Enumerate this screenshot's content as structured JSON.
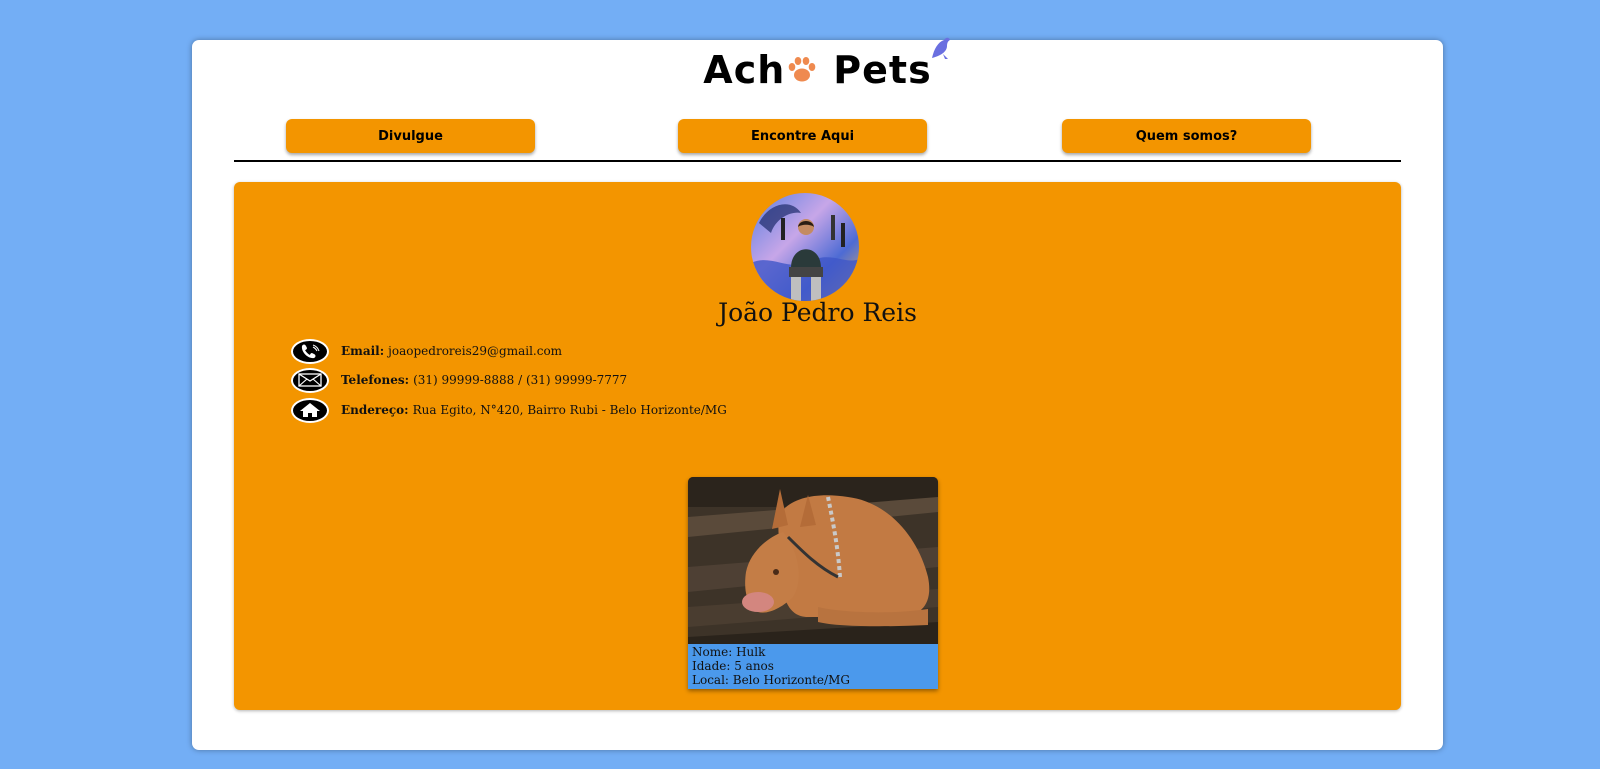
{
  "logo": {
    "part1": "Ach",
    "part2": "Pets"
  },
  "nav": {
    "items": [
      {
        "label": "Divulgue"
      },
      {
        "label": "Encontre Aqui"
      },
      {
        "label": "Quem somos?"
      }
    ]
  },
  "profile": {
    "name": "João Pedro Reis",
    "contacts": [
      {
        "label": "Email:",
        "value": "joaopedroreis29@gmail.com",
        "icon": "phone-icon"
      },
      {
        "label": "Telefones:",
        "value": "(31) 99999-8888 / (31) 99999-7777",
        "icon": "envelope-icon"
      },
      {
        "label": "Endereço:",
        "value": "Rua Egito, N°420, Bairro Rubi - Belo Horizonte/MG",
        "icon": "home-icon"
      }
    ]
  },
  "pet": {
    "name_line": "Nome: Hulk",
    "age_line": "Idade: 5 anos",
    "location_line": "Local: Belo Horizonte/MG"
  },
  "colors": {
    "background": "#73aef5",
    "accent": "#f39500",
    "pet_info": "#4b99ec"
  }
}
